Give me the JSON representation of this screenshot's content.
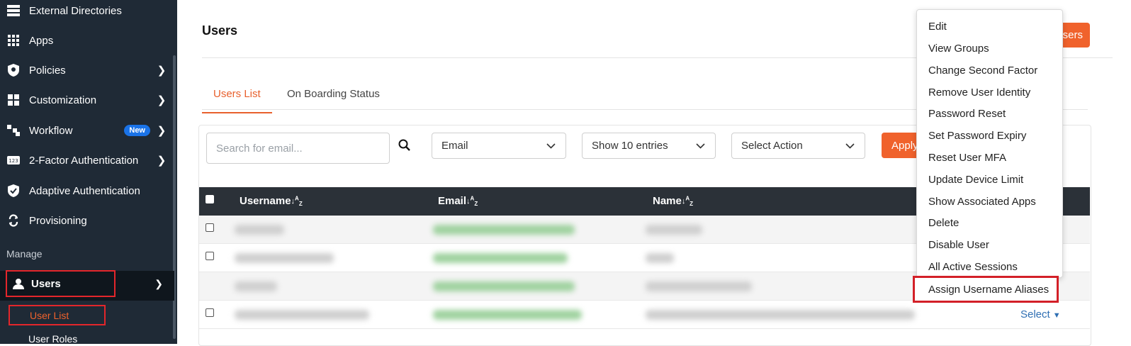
{
  "sidebar": {
    "items": [
      {
        "label": "External Directories",
        "icon": "directory-icon",
        "has_chevron": false
      },
      {
        "label": "Apps",
        "icon": "grid-icon",
        "has_chevron": false
      },
      {
        "label": "Policies",
        "icon": "policy-icon",
        "has_chevron": true
      },
      {
        "label": "Customization",
        "icon": "customization-icon",
        "has_chevron": true
      },
      {
        "label": "Workflow",
        "icon": "workflow-icon",
        "has_chevron": true,
        "badge": "New"
      },
      {
        "label": "2-Factor Authentication",
        "icon": "2fa-icon",
        "has_chevron": true
      },
      {
        "label": "Adaptive Authentication",
        "icon": "shield-check-icon",
        "has_chevron": false
      },
      {
        "label": "Provisioning",
        "icon": "sync-icon",
        "has_chevron": false
      }
    ],
    "section_label": "Manage",
    "users_label": "Users",
    "user_list_label": "User List",
    "user_roles_label": "User Roles",
    "accent_color": "#f0622c",
    "background_color": "#1f2a36"
  },
  "header": {
    "title": "Users",
    "add_users_label": "Users"
  },
  "tabs": [
    {
      "label": "Users List",
      "active": true
    },
    {
      "label": "On Boarding Status",
      "active": false
    }
  ],
  "toolbar": {
    "search_placeholder": "Search for email...",
    "filter_select": "Email",
    "entries_select": "Show 10 entries",
    "action_select": "Select Action",
    "apply_label": "Apply"
  },
  "table": {
    "columns": [
      "Username",
      "Email",
      "Name"
    ],
    "row_action_label": "Select"
  },
  "action_menu": {
    "items": [
      "Edit",
      "View Groups",
      "Change Second Factor",
      "Remove User Identity",
      "Password Reset",
      "Set Password Expiry",
      "Reset User MFA",
      "Update Device Limit",
      "Show Associated Apps",
      "Delete",
      "Disable User",
      "All Active Sessions"
    ],
    "highlighted_item": "Assign Username Aliases",
    "highlight_color": "#d32028"
  }
}
